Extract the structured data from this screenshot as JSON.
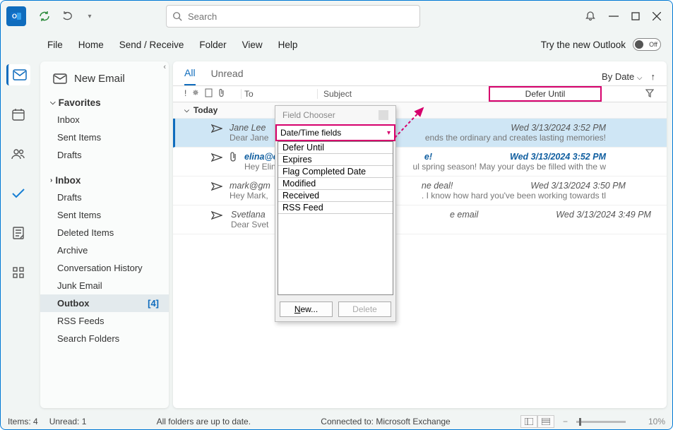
{
  "titlebar": {
    "app_initial": "o",
    "search_placeholder": "Search"
  },
  "menubar": {
    "items": [
      "File",
      "Home",
      "Send / Receive",
      "Folder",
      "View",
      "Help"
    ],
    "try_new": "Try the new Outlook",
    "toggle_label": "Off"
  },
  "nav": {
    "new_email": "New Email",
    "favorites_label": "Favorites",
    "favorites": [
      "Inbox",
      "Sent Items",
      "Drafts"
    ],
    "inbox_label": "Inbox",
    "inbox_tree": [
      {
        "label": "Drafts"
      },
      {
        "label": "Sent Items"
      },
      {
        "label": "Deleted Items"
      },
      {
        "label": "Archive"
      },
      {
        "label": "Conversation History"
      },
      {
        "label": "Junk Email"
      },
      {
        "label": "Outbox",
        "badge": "[4]",
        "selected": true
      },
      {
        "label": "RSS Feeds"
      },
      {
        "label": "Search Folders"
      }
    ]
  },
  "tabs": {
    "all": "All",
    "unread": "Unread",
    "sort_label": "By Date"
  },
  "columns": {
    "to": "To",
    "subject": "Subject",
    "defer": "Defer Until"
  },
  "group": "Today",
  "emails": [
    {
      "from": "Jane Lee",
      "preview": "Dear Jane",
      "date": "Wed 3/13/2024 3:52 PM",
      "snippet": "ends the ordinary and creates lasting memories!",
      "selected": true
    },
    {
      "from": "elina@co",
      "preview": "Hey Elina,",
      "date": "Wed 3/13/2024 3:52 PM",
      "snippet_top": "e!",
      "snippet": "ul spring season! May your days be filled with the w",
      "attachment": true,
      "unread": true
    },
    {
      "from": "mark@gm",
      "preview": "Hey Mark,",
      "date": "Wed 3/13/2024 3:50 PM",
      "snippet_top": "ne deal!",
      "snippet": ". I know how hard you've been working towards tl"
    },
    {
      "from": "Svetlana",
      "preview": "Dear Svet",
      "date": "Wed 3/13/2024 3:49 PM",
      "snippet_top": "e email"
    }
  ],
  "field_chooser": {
    "title": "Field Chooser",
    "dropdown": "Date/Time fields",
    "items": [
      "Defer Until",
      "Expires",
      "Flag Completed Date",
      "Modified",
      "Received",
      "RSS Feed"
    ],
    "new_btn": "New...",
    "delete_btn": "Delete"
  },
  "statusbar": {
    "items": "Items: 4",
    "unread": "Unread: 1",
    "center": "All folders are up to date.",
    "connected": "Connected to: Microsoft Exchange",
    "zoom": "10%"
  }
}
